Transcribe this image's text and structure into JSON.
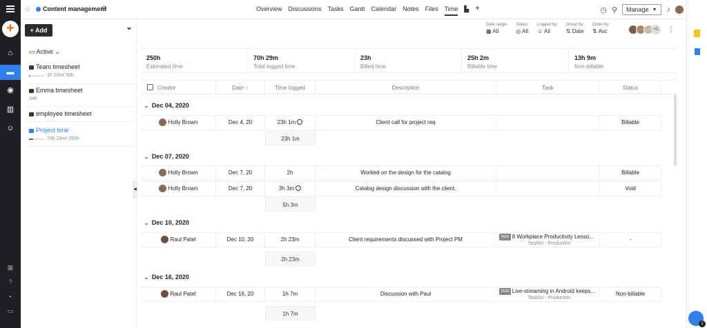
{
  "header": {
    "project_name": "Content management",
    "nav": [
      "Overview",
      "Discussions",
      "Tasks",
      "Gantt",
      "Calendar",
      "Notes",
      "Files",
      "Time"
    ],
    "active_nav": "Time",
    "manage_label": "Manage"
  },
  "sidebar": {
    "add_label": "Add",
    "filter_label": "Active",
    "timesheets": [
      {
        "name": "Team timesheet",
        "sub": "1h 10m/ 50h",
        "progress": 0.02,
        "selected": false
      },
      {
        "name": "Emma timesheet",
        "sub": "34h",
        "selected": false
      },
      {
        "name": "employee timesheet",
        "sub": "",
        "selected": false
      },
      {
        "name": "Project time",
        "sub": "70h 29m/ 250h",
        "progress": 0.28,
        "selected": true
      }
    ]
  },
  "filters": [
    {
      "label": "Date range:",
      "value": "All",
      "icon": "calendar-icon"
    },
    {
      "label": "Status:",
      "value": "All",
      "icon": "check-circle-icon"
    },
    {
      "label": "Logged by:",
      "value": "All",
      "icon": "users-icon"
    },
    {
      "label": "Group by:",
      "value": "Date",
      "icon": "sort-icon"
    },
    {
      "label": "Order by:",
      "value": "Asc",
      "icon": "sort-icon"
    }
  ],
  "members_more": "+1",
  "stats": [
    {
      "value": "250h",
      "label": "Estimated time"
    },
    {
      "value": "70h 29m",
      "label": "Total logged time"
    },
    {
      "value": "23h",
      "label": "Billed time"
    },
    {
      "value": "25h 2m",
      "label": "Billable time"
    },
    {
      "value": "13h 9m",
      "label": "Non-billable"
    }
  ],
  "columns": {
    "creator": "Creator",
    "date": "Date",
    "time": "Time logged",
    "description": "Description",
    "task": "Task",
    "status": "Status"
  },
  "groups": [
    {
      "date": "Dec 04, 2020",
      "subtotal": "23h 1m",
      "rows": [
        {
          "creator": "Holly Brown",
          "date": "Dec 4, 20",
          "time": "23h 1m",
          "timer": true,
          "description": "Client call for project req",
          "task": "",
          "tasklist": "",
          "status": "Billable"
        }
      ]
    },
    {
      "date": "Dec 07, 2020",
      "subtotal": "5h 3m",
      "rows": [
        {
          "creator": "Holly Brown",
          "date": "Dec 7, 20",
          "time": "2h",
          "timer": false,
          "description": "Worked on the design for the catalog",
          "task": "",
          "tasklist": "",
          "status": "Billable"
        },
        {
          "creator": "Holly Brown",
          "date": "Dec 7, 20",
          "time": "3h 3m",
          "timer": true,
          "description": "Catalog design discussion with the client.",
          "task": "",
          "tasklist": "",
          "status": "Void"
        }
      ]
    },
    {
      "date": "Dec 10, 2020",
      "subtotal": "2h 23m",
      "rows": [
        {
          "creator": "Raul Patel",
          "date": "Dec 10, 20",
          "time": "2h 23m",
          "timer": false,
          "description": "Client requirements discussed with Project PM",
          "task": "8 Workplace Productivity Lesso...",
          "tasklist": "Tasklist",
          "tasklist_suffix": " - Production",
          "status": "-"
        }
      ]
    },
    {
      "date": "Dec 16, 2020",
      "subtotal": "1h 7m",
      "rows": [
        {
          "creator": "Raul Patel",
          "date": "Dec 16, 20",
          "time": "1h 7m",
          "timer": false,
          "description": "Discussion with Paul",
          "task": "Live-streaming in Android keeps...",
          "tasklist": "Tasklist",
          "tasklist_suffix": " - Production",
          "status": "Non-billable"
        }
      ]
    }
  ],
  "task_tag": "TASK",
  "notification_count": "1"
}
